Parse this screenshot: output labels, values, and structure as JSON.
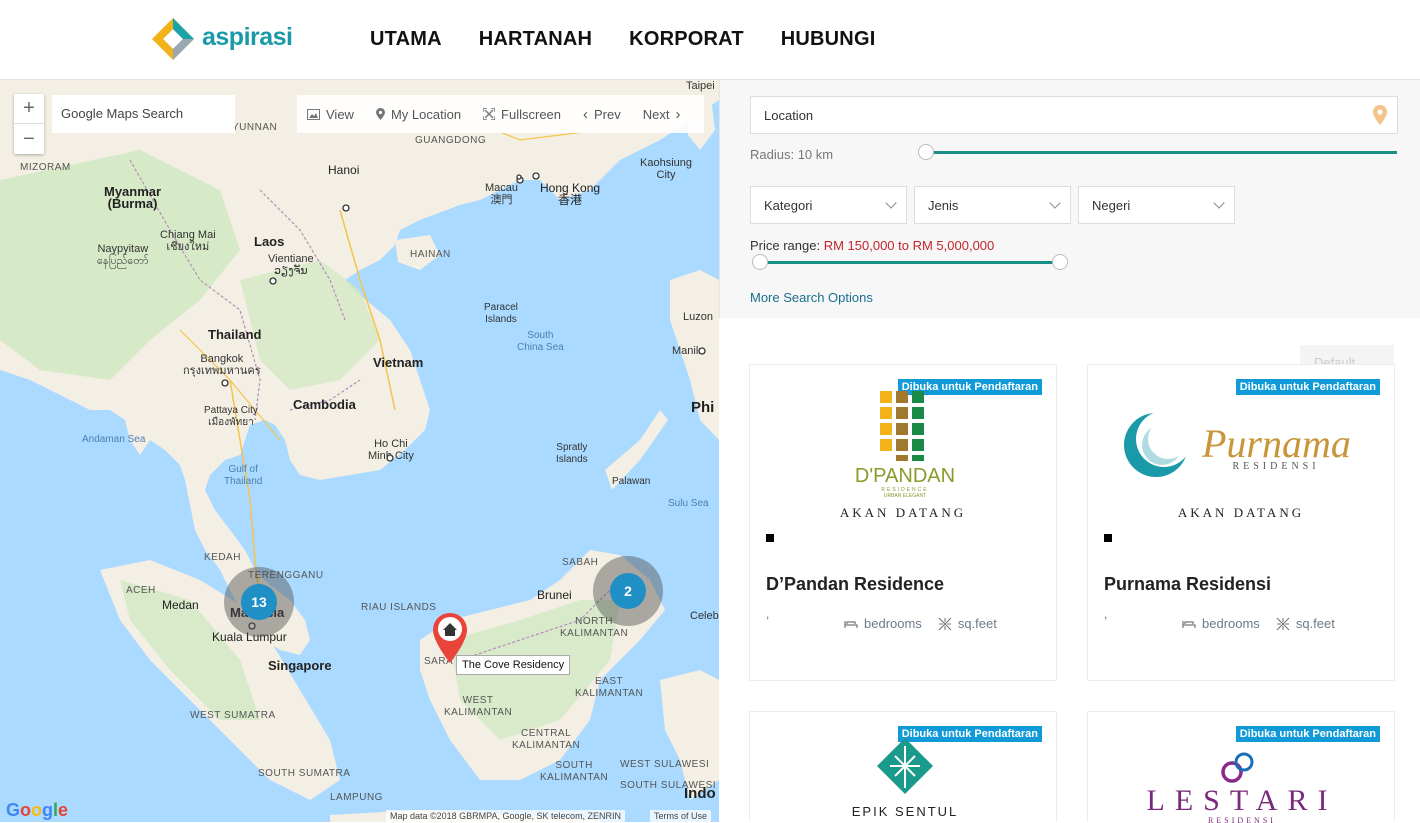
{
  "brand": {
    "name": "aspirasi"
  },
  "nav": {
    "items": [
      "UTAMA",
      "HARTANAH",
      "KORPORAT",
      "HUBUNGI"
    ]
  },
  "map": {
    "zoom_in": "+",
    "zoom_out": "−",
    "search_placeholder": "Google Maps Search",
    "toolbar": {
      "view": "View",
      "my_location": "My Location",
      "fullscreen": "Fullscreen",
      "prev": "Prev",
      "next": "Next"
    },
    "labels": {
      "taipei": "Taipei",
      "kaohsiung": "Kaohsiung\nCity",
      "myanmar": "Myanmar\n(Burma)",
      "mizoram": "MIZORAM",
      "yunnan": "YUNNAN",
      "guangdong": "GUANGDONG",
      "hanoi": "Hanoi",
      "macau": "Macau\n澳門",
      "hongkong": "Hong Kong\n香港",
      "chiangmai": "Chiang Mai\nเชียงใหม่",
      "naypyitaw": "Naypyitaw\nနေပြည်တော်",
      "laos": "Laos",
      "vientiane": "Vientiane\nວຽງຈັນ",
      "hainan": "HAINAN",
      "paracel": "Paracel\nIslands",
      "southchinasea": "South\nChina Sea",
      "luzon": "Luzon",
      "manila": "Manila",
      "thailand": "Thailand",
      "bangkok": "Bangkok\nกรุงเทพมหานคร",
      "vietnam": "Vietnam",
      "cambodia": "Cambodia",
      "pattaya": "Pattaya City\nเมืองพัทยา",
      "andaman": "Andaman Sea",
      "hochiminh": "Ho Chi\nMinh City",
      "spratly": "Spratly\nIslands",
      "phi": "Phi",
      "gulf": "Gulf of\nThailand",
      "palawan": "Palawan",
      "sulu": "Sulu Sea",
      "kedah": "KEDAH",
      "terengganu": "TERENGGANU",
      "sabah": "SABAH",
      "aceh": "ACEH",
      "medan": "Medan",
      "malaysia": "Malaysia",
      "kualalumpur": "Kuala Lumpur",
      "riau": "RIAU ISLANDS",
      "brunei": "Brunei",
      "celeb": "Celeb",
      "northkal": "NORTH\nKALIMANTAN",
      "singapore": "Singapore",
      "sara": "SARA",
      "eastkal": "EAST\nKALIMANTAN",
      "westkal": "WEST\nKALIMANTAN",
      "centralkal": "CENTRAL\nKALIMANTAN",
      "westsumatra": "WEST SUMATRA",
      "southsumatra": "SOUTH SUMATRA",
      "southkal": "SOUTH\nKALIMANTAN",
      "westsulawesi": "WEST SULAWESI",
      "southsulawesi": "SOUTH SULAWESI",
      "lampung": "LAMPUNG",
      "indo": "Indo"
    },
    "clusters": [
      {
        "count": "13"
      },
      {
        "count": "2"
      }
    ],
    "pin_label": "The Cove Residency",
    "google": "Google",
    "attribution": "Map data ©2018 GBRMPA, Google, SK telecom, ZENRIN",
    "terms": "Terms of Use"
  },
  "search": {
    "location_placeholder": "Location",
    "radius_label": "Radius: 10 km",
    "radius_km": 10,
    "selects": [
      "Kategori",
      "Jenis",
      "Negeri"
    ],
    "price_label": "Price range:",
    "price_value": "RM 150,000 to RM 5,000,000",
    "more_options": "More Search Options",
    "sort": "Default"
  },
  "listings": [
    {
      "badge": "Dibuka untuk Pendaftaran",
      "logo_text": "D'PANDAN",
      "logo_sub": "RESIDENCE",
      "logo_tag": "URBAN ELEGANT",
      "status": "AKAN DATANG",
      "title": "D’Pandan Residence",
      "comma": ",",
      "bedrooms": "bedrooms",
      "sqfeet": "sq.feet"
    },
    {
      "badge": "Dibuka untuk Pendaftaran",
      "logo_text": "Purnama",
      "logo_sub": "RESIDENSI",
      "status": "AKAN DATANG",
      "title": "Purnama Residensi",
      "comma": ",",
      "bedrooms": "bedrooms",
      "sqfeet": "sq.feet"
    },
    {
      "badge": "Dibuka untuk Pendaftaran",
      "logo_text": "EPIK SENTUL"
    },
    {
      "badge": "Dibuka untuk Pendaftaran",
      "logo_text": "LESTARI",
      "logo_sub": "RESIDENSI"
    }
  ],
  "colors": {
    "accent": "#1a8f86",
    "badge": "#109bd8",
    "price": "#c0262d",
    "cluster": "#1f8fc6",
    "pin": "#e8443a"
  }
}
